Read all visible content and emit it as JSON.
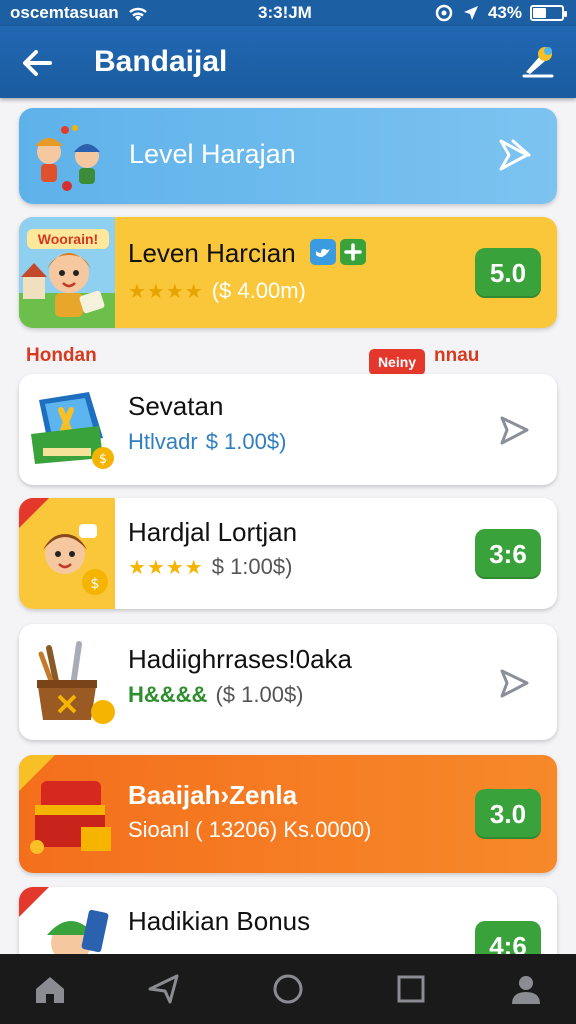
{
  "status_bar": {
    "carrier": "oscemtasuan",
    "time": "3:3!JM",
    "battery": "43%",
    "battery_level": 0.43
  },
  "app_bar": {
    "title": "Bandaijal",
    "back_icon": "arrow-left-icon",
    "tool_icon": "paint-brush-icon"
  },
  "banner": {
    "label": "Level Harajan"
  },
  "featured": {
    "sign": "Woorain!",
    "name": "Leven Harcian",
    "stars": "★★★★",
    "price": "($ 4.00m)",
    "score": "5.0"
  },
  "section": {
    "label": "Hondan",
    "badge": "Neiny",
    "tag": "nnau"
  },
  "items": [
    {
      "name": "Sevatan",
      "prefix": "Htlvadr",
      "price": "$ 1.00$)",
      "action": "play"
    },
    {
      "name": "Hardjal Lortjan",
      "stars": "★★★★",
      "price": "$ 1:00$)",
      "score": "3:6"
    },
    {
      "name": "Hadiighrrases!0aka",
      "prefix": "H&&&&",
      "price": "($ 1.00$)",
      "action": "play"
    },
    {
      "name": "Baaijah›Zenla",
      "price": "Sioanl ( 13206) Ks.0000)",
      "score": "3.0"
    },
    {
      "name": "Hadikian Bonus",
      "score": "4:6"
    }
  ],
  "colors": {
    "status_bar": "#1d5fa3",
    "app_bar": "#2168b3",
    "banner": "#6ab8ec",
    "featured": "#fbc73a",
    "score_green": "#3aa23b",
    "orange": "#f2731f",
    "badge_red": "#e5382c"
  },
  "nav": {
    "items": [
      "home-icon",
      "back-triangle-icon",
      "circle-home-icon",
      "recents-square-icon",
      "profile-icon"
    ]
  }
}
